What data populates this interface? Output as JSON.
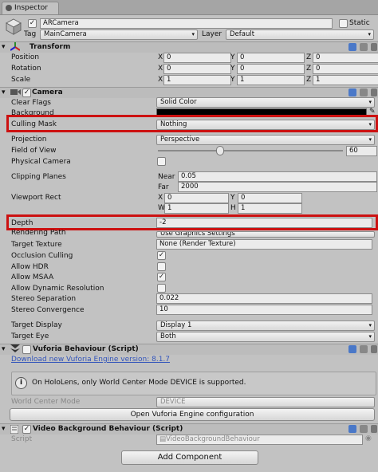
{
  "tab": {
    "title": "Inspector"
  },
  "object": {
    "name": "ARCamera",
    "static_label": "Static",
    "tag_label": "Tag",
    "tag": "MainCamera",
    "layer_label": "Layer",
    "layer": "Default"
  },
  "transform": {
    "title": "Transform",
    "position": {
      "label": "Position",
      "x": "0",
      "y": "0",
      "z": "0"
    },
    "rotation": {
      "label": "Rotation",
      "x": "0",
      "y": "0",
      "z": "0"
    },
    "scale": {
      "label": "Scale",
      "x": "1",
      "y": "1",
      "z": "1"
    },
    "axes": {
      "x": "X",
      "y": "Y",
      "z": "Z"
    }
  },
  "camera": {
    "title": "Camera",
    "clear_flags": {
      "label": "Clear Flags",
      "value": "Solid Color"
    },
    "background": {
      "label": "Background",
      "color": "#000000"
    },
    "culling_mask": {
      "label": "Culling Mask",
      "value": "Nothing"
    },
    "projection": {
      "label": "Projection",
      "value": "Perspective"
    },
    "fov": {
      "label": "Field of View",
      "value": "60",
      "slider_fraction": 0.33
    },
    "physical_camera": {
      "label": "Physical Camera",
      "checked": false
    },
    "clipping": {
      "label": "Clipping Planes",
      "near_label": "Near",
      "near": "0.05",
      "far_label": "Far",
      "far": "2000"
    },
    "viewport": {
      "label": "Viewport Rect",
      "x_label": "X",
      "x": "0",
      "y_label": "Y",
      "y": "0",
      "w_label": "W",
      "w": "1",
      "h_label": "H",
      "h": "1"
    },
    "depth": {
      "label": "Depth",
      "value": "-2"
    },
    "rendering_path": {
      "label": "Rendering Path",
      "value": "Use Graphics Settings"
    },
    "target_texture": {
      "label": "Target Texture",
      "value": "None (Render Texture)"
    },
    "occlusion": {
      "label": "Occlusion Culling",
      "checked": true
    },
    "hdr": {
      "label": "Allow HDR",
      "checked": false
    },
    "msaa": {
      "label": "Allow MSAA",
      "checked": true
    },
    "dynres": {
      "label": "Allow Dynamic Resolution",
      "checked": false
    },
    "stereo_sep": {
      "label": "Stereo Separation",
      "value": "0.022"
    },
    "stereo_conv": {
      "label": "Stereo Convergence",
      "value": "10"
    },
    "target_display": {
      "label": "Target Display",
      "value": "Display 1"
    },
    "target_eye": {
      "label": "Target Eye",
      "value": "Both"
    }
  },
  "vuforia": {
    "title": "Vuforia Behaviour (Script)",
    "download_link": "Download new Vuforia Engine version: 8.1.7",
    "info": "On HoloLens, only World Center Mode DEVICE is supported.",
    "wcm_label": "World Center Mode",
    "wcm_value": "DEVICE",
    "open_config": "Open Vuforia Engine configuration"
  },
  "video_bg": {
    "title": "Video Background Behaviour (Script)",
    "script_label": "Script",
    "script_value": "VideoBackgroundBehaviour"
  },
  "add_component": "Add Component",
  "check_glyph": "✓",
  "colors": {
    "highlight": "#cc1111",
    "panel": "#c2c2c2",
    "link": "#3355bb"
  }
}
